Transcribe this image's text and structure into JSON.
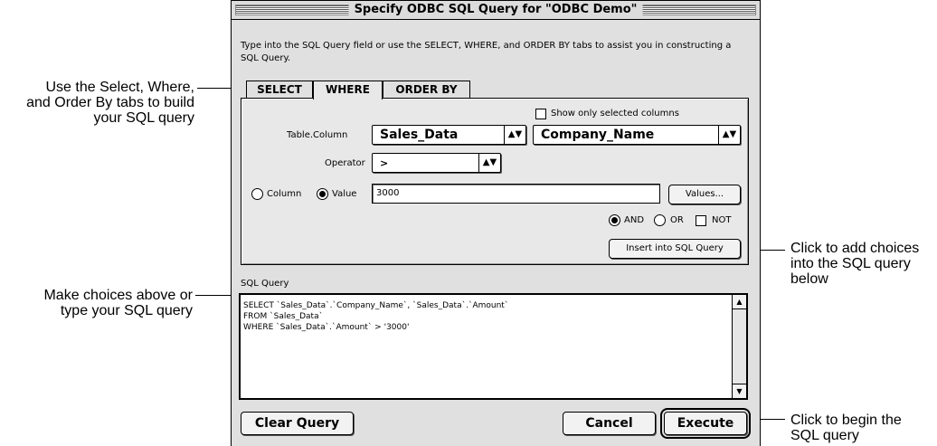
{
  "dialog": {
    "title": "Specify ODBC SQL Query for \"ODBC Demo\"",
    "intro": "Type into the SQL Query field or use the SELECT, WHERE, and ORDER BY tabs to assist you in constructing a SQL Query."
  },
  "tabs": [
    {
      "label": "SELECT",
      "active": false
    },
    {
      "label": "WHERE",
      "active": true
    },
    {
      "label": "ORDER BY",
      "active": false
    }
  ],
  "where": {
    "show_selected_label": "Show only selected columns",
    "table_column_label": "Table.Column",
    "table_value": "Sales_Data",
    "column_value": "Company_Name",
    "operator_label": "Operator",
    "operator_value": ">",
    "column_radio_label": "Column",
    "value_radio_label": "Value",
    "value_input": "3000",
    "values_button": "Values...",
    "and_label": "AND",
    "or_label": "OR",
    "not_label": "NOT",
    "insert_button": "Insert into SQL Query"
  },
  "sql": {
    "label": "SQL Query",
    "text": "SELECT `Sales_Data`.`Company_Name`, `Sales_Data`.`Amount`\nFROM `Sales_Data`\nWHERE `Sales_Data`.`Amount` > '3000'"
  },
  "buttons": {
    "clear": "Clear Query",
    "cancel": "Cancel",
    "execute": "Execute"
  },
  "callouts": {
    "tabs": "Use the Select, Where,\nand Order By tabs to build\nyour SQL query",
    "sql": "Make choices above or\ntype your SQL query",
    "insert": "Click to add choices\ninto the SQL query\nbelow",
    "execute": "Click to begin the\nSQL query"
  },
  "icons": {
    "popup_arrows": "up-down-arrows-icon",
    "scroll_up": "scroll-up-arrow-icon",
    "scroll_down": "scroll-down-arrow-icon"
  }
}
